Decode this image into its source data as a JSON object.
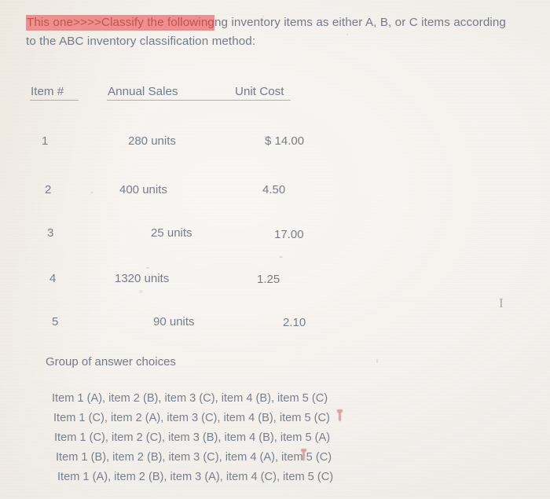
{
  "page": {
    "background_color": "#f6f3ef",
    "body_text_color": "#6e7886",
    "highlight_color": "#f08d8d",
    "highlight_text_color": "#c0504a"
  },
  "prompt": {
    "highlighted_text": "This one>>>>Classify the following",
    "rest_line1": "ng inventory items as either A, B, or C items according",
    "line2": "to the ABC inventory classification method:"
  },
  "table": {
    "headers": [
      "Item #",
      "Annual Sales",
      "Unit Cost"
    ],
    "rows": [
      {
        "item": "1",
        "annual_sales": "280 units",
        "unit_cost": "$ 14.00"
      },
      {
        "item": "2",
        "annual_sales": "400 units",
        "unit_cost": "4.50"
      },
      {
        "item": "3",
        "annual_sales": "25 units",
        "unit_cost": "17.00"
      },
      {
        "item": "4",
        "annual_sales": "1320 units",
        "unit_cost": "1.25"
      },
      {
        "item": "5",
        "annual_sales": "90 units",
        "unit_cost": "2.10"
      }
    ]
  },
  "answers": {
    "title": "Group of answer choices",
    "choices": [
      "Item 1 (A), item 2 (B), item 3 (C), item 4 (B), item 5 (C)",
      "Item 1 (C), item 2 (A), item 3 (C), item 4 (B), item 5 (C)",
      "Item 1 (C), item 2 (C), item 3 (B), item 4 (B), item 5 (A)",
      "Item 1 (B), item 2 (B), item 3 (C), item 4 (A), item 5 (C)",
      "Item 1 (A), item 2 (B), item 3 (A), item 4 (C), item 5 (C)"
    ]
  },
  "cursor": {
    "glyph": "I"
  }
}
